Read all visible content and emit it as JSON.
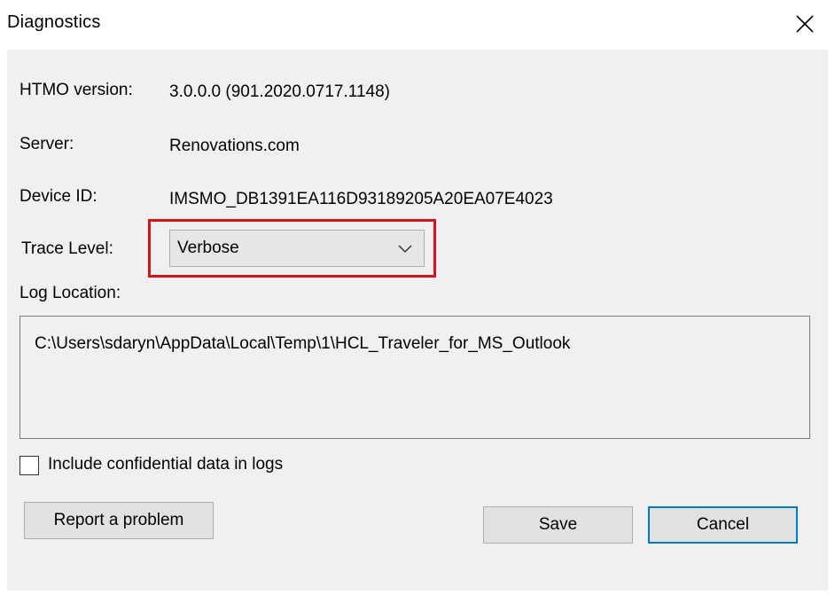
{
  "window": {
    "title": "Diagnostics",
    "close_icon": "close-icon"
  },
  "info": {
    "htmo_version_label": "HTMO version:",
    "htmo_version_value": "3.0.0.0 (901.2020.0717.1148)",
    "server_label": "Server:",
    "server_value": "Renovations.com",
    "device_id_label": "Device ID:",
    "device_id_value": "IMSMO_DB1391EA116D93189205A20EA07E4023"
  },
  "trace": {
    "label": "Trace Level:",
    "selected": "Verbose",
    "highlight_color": "#e0101a"
  },
  "log": {
    "label": "Log Location:",
    "path": "C:\\Users\\sdaryn\\AppData\\Local\\Temp\\1\\HCL_Traveler_for_MS_Outlook"
  },
  "confidential": {
    "label": "Include confidential data in logs",
    "checked": false
  },
  "buttons": {
    "report": "Report a problem",
    "save": "Save",
    "cancel": "Cancel",
    "focus_color": "#0078d7"
  }
}
